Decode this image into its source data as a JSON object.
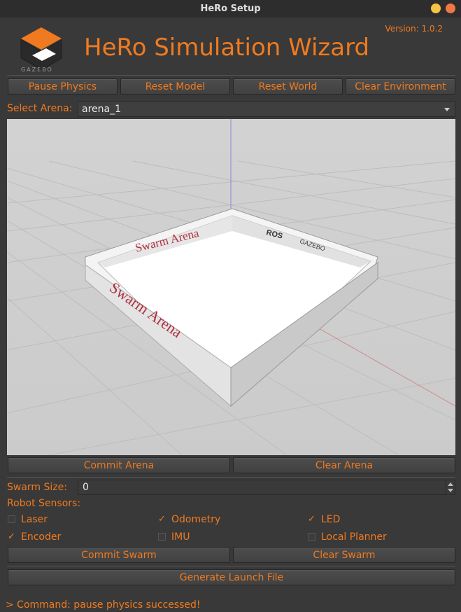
{
  "window": {
    "title": "HeRo Setup"
  },
  "header": {
    "app_title": "HeRo Simulation Wizard",
    "version": "Version: 1.0.2",
    "logo_text": "GAZEBO"
  },
  "toolbar": {
    "pause_physics": "Pause Physics",
    "reset_model": "Reset Model",
    "reset_world": "Reset World",
    "clear_environment": "Clear Environment"
  },
  "arena": {
    "label": "Select Arena:",
    "selected": "arena_1"
  },
  "scene": {
    "front_wall_text": "Swarm Arena",
    "back_wall_text": "Swarm Arena",
    "ros_logo": "ROS",
    "gazebo_logo": "GAZEBO"
  },
  "arena_actions": {
    "commit": "Commit Arena",
    "clear": "Clear Arena"
  },
  "swarm": {
    "size_label": "Swarm Size:",
    "size_value": "0",
    "sensors_label": "Robot Sensors:"
  },
  "sensors": [
    {
      "label": "Laser",
      "checked": false
    },
    {
      "label": "Odometry",
      "checked": true
    },
    {
      "label": "LED",
      "checked": true
    },
    {
      "label": "Encoder",
      "checked": true
    },
    {
      "label": "IMU",
      "checked": false
    },
    {
      "label": "Local Planner",
      "checked": false
    }
  ],
  "swarm_actions": {
    "commit": "Commit Swarm",
    "clear": "Clear Swarm"
  },
  "launch": {
    "generate": "Generate Launch File"
  },
  "status": {
    "message": "> Command: pause physics successed!"
  },
  "colors": {
    "accent": "#f07a1f",
    "background": "#393939",
    "viewport": "#cfcfcf"
  }
}
